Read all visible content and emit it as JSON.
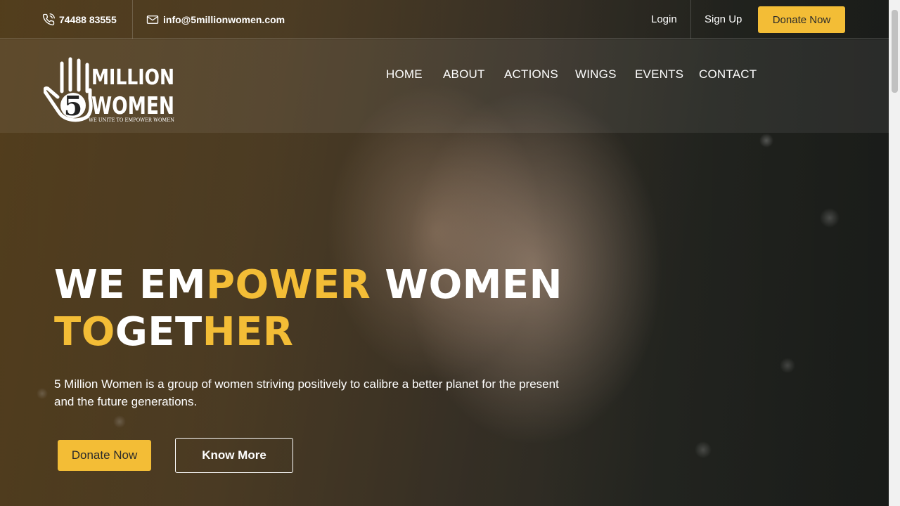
{
  "topbar": {
    "phone": "74488 83555",
    "email": "info@5millionwomen.com",
    "login_label": "Login",
    "signup_label": "Sign Up",
    "donate_label": "Donate Now"
  },
  "logo": {
    "number": "5",
    "line1": "MILLION",
    "line2": "WOMEN",
    "tagline": "WE UNITE TO EMPOWER WOMEN"
  },
  "nav": {
    "items": [
      "HOME",
      "ABOUT",
      "ACTIONS",
      "WINGS",
      "EVENTS",
      "CONTACT"
    ]
  },
  "hero": {
    "headline": {
      "p1": "WE EM",
      "p2": "POWER",
      "p3": " WOMEN",
      "p4": "TO",
      "p5": "GET",
      "p6": "HER"
    },
    "tagline": "5 Million Women is a group of women striving positively to calibre a better planet for the present and the future generations.",
    "donate_label": "Donate Now",
    "know_more_label": "Know More"
  },
  "colors": {
    "accent": "#f3bd36",
    "text": "#ffffff"
  },
  "icons": {
    "phone": "phone-icon",
    "email": "mail-icon"
  }
}
